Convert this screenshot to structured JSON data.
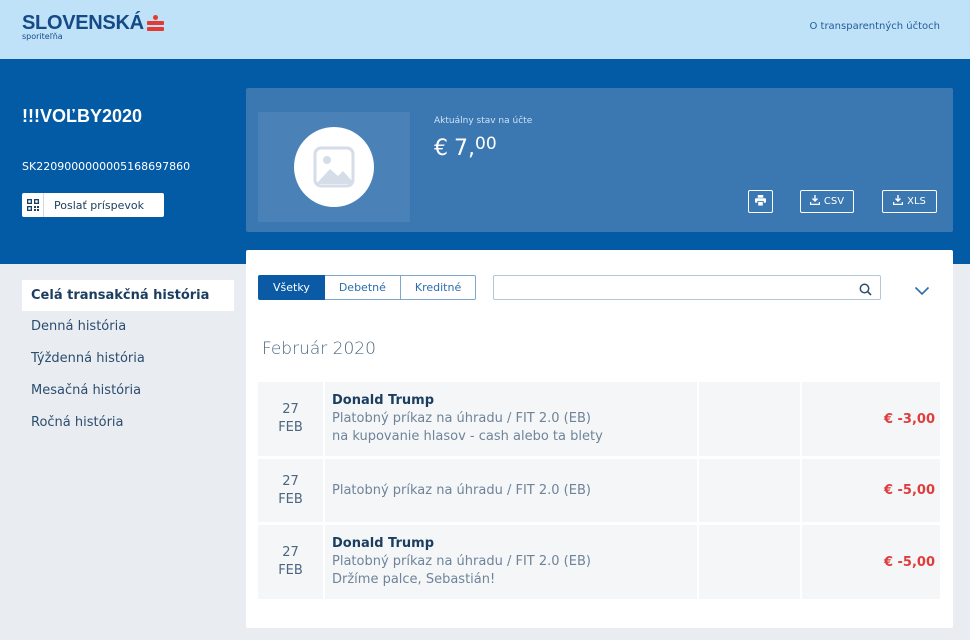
{
  "header": {
    "brand": "SLOVENSKÁ",
    "brand_sub": "sporiteľňa",
    "link": "O transparentných účtoch"
  },
  "account": {
    "name": "!!!VOĽBY2020",
    "iban": "SK2209000000005168697860",
    "send_button": "Poslať príspevok"
  },
  "balance": {
    "label": "Aktuálny stav na účte",
    "currency": "€",
    "integer": "7,",
    "decimal": "00"
  },
  "export": {
    "csv": "CSV",
    "xls": "XLS"
  },
  "sidebar": {
    "items": [
      {
        "label": "Celá transakčná história",
        "active": true
      },
      {
        "label": "Denná história"
      },
      {
        "label": "Týždenná história"
      },
      {
        "label": "Mesačná história"
      },
      {
        "label": "Ročná história"
      }
    ]
  },
  "filters": {
    "all": "Všetky",
    "debit": "Debetné",
    "credit": "Kreditné"
  },
  "search": {
    "placeholder": ""
  },
  "month_heading": "Február 2020",
  "transactions": [
    {
      "day": "27",
      "month": "FEB",
      "name": "Donald Trump",
      "line1": "Platobný príkaz na úhradu / FIT 2.0 (EB)",
      "line2": "na kupovanie hlasov - cash alebo ta blety",
      "amount": "€ -3,00"
    },
    {
      "day": "27",
      "month": "FEB",
      "name": "",
      "line1": "Platobný príkaz na úhradu / FIT 2.0 (EB)",
      "line2": "",
      "amount": "€ -5,00"
    },
    {
      "day": "27",
      "month": "FEB",
      "name": "Donald Trump",
      "line1": "Platobný príkaz na úhradu / FIT 2.0 (EB)",
      "line2": "Držíme palce, Sebastián!",
      "amount": "€ -5,00"
    }
  ],
  "colors": {
    "header_bg": "#bfe2f8",
    "band_bg": "#035aa5",
    "panel_bg": "#3b77b1",
    "negative": "#e03c3c",
    "brand_red": "#e33b32"
  },
  "icons": {
    "qr": "qr-code-icon",
    "avatar": "image-placeholder-icon",
    "print": "print-icon",
    "download": "download-icon",
    "search": "search-icon",
    "expand": "chevron-down-icon"
  }
}
